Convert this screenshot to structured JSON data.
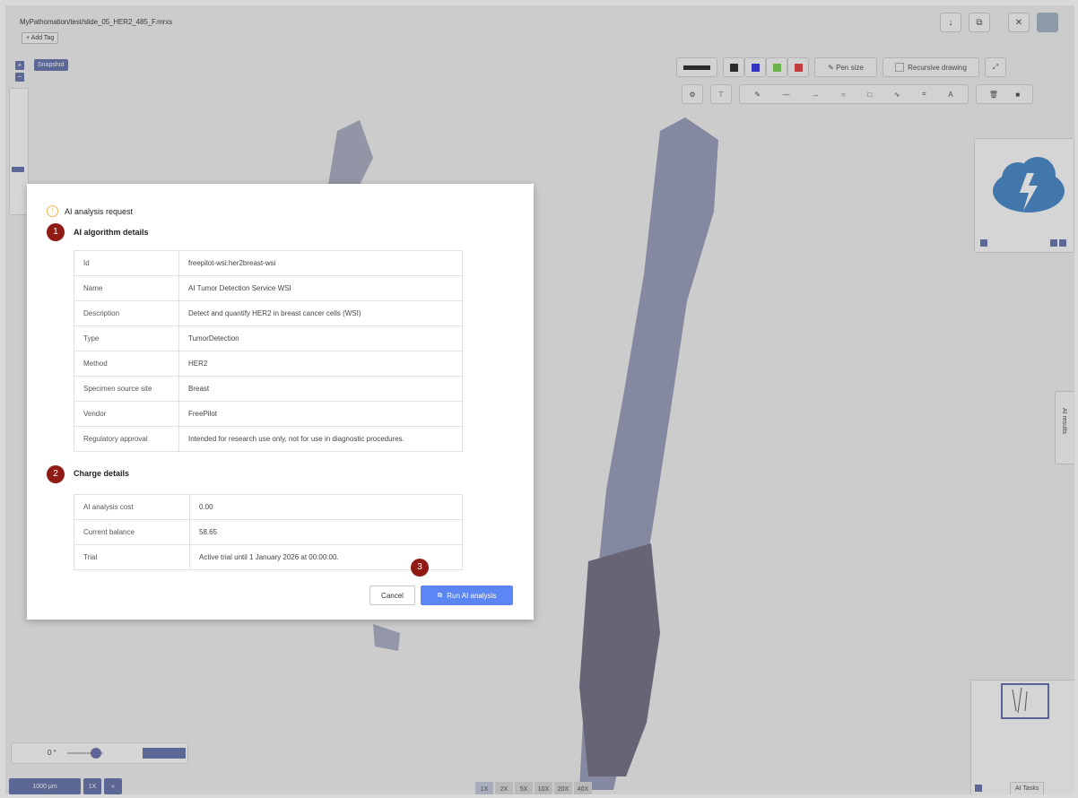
{
  "window": {
    "path": "MyPathomation/test/slide_05_HER2_485_F.mrxs",
    "add_tag": "+ Add Tag"
  },
  "viewer": {
    "snapshot_label": "Snapshot",
    "zoom_in": "+",
    "zoom_out": "−",
    "toolbar": {
      "pen_size": "Pen size",
      "recursive_drawing": "Recursive drawing"
    },
    "rotation": "0 °",
    "scale": "1000 µm",
    "scale_unit": "1X",
    "magnifications": [
      "1X",
      "2X",
      "5X",
      "10X",
      "20X",
      "40X"
    ],
    "ai_tasks": "AI Tasks",
    "ai_results_tab": "AI results"
  },
  "modal": {
    "header": "AI analysis request",
    "section1": {
      "badge": "1",
      "title": "AI algorithm details"
    },
    "algorithm": [
      {
        "k": "Id",
        "v": "freepilot-wsi:her2breast-wsi"
      },
      {
        "k": "Name",
        "v": "AI Tumor Detection Service WSI"
      },
      {
        "k": "Description",
        "v": "Detect and quantify HER2 in breast cancer cells (WSI)"
      },
      {
        "k": "Type",
        "v": "TumorDetection"
      },
      {
        "k": "Method",
        "v": "HER2"
      },
      {
        "k": "Specimen source site",
        "v": "Breast"
      },
      {
        "k": "Vendor",
        "v": "FreePilot"
      },
      {
        "k": "Regulatory approval",
        "v": "Intended for research use only, not for use in diagnostic procedures."
      }
    ],
    "section2": {
      "badge": "2",
      "title": "Charge details"
    },
    "charge": [
      {
        "k": "AI analysis cost",
        "v": "0.00"
      },
      {
        "k": "Current balance",
        "v": "58.65"
      },
      {
        "k": "Trial",
        "v": "Active trial until 1 January 2026 at 00:00:00."
      }
    ],
    "badge3": "3",
    "cancel": "Cancel",
    "run": "Run AI analysis"
  },
  "colors": {
    "accent": "#5f6ea8",
    "run_button": "#5b86f4",
    "badge": "#8f1b14",
    "info": "#f0b44c"
  }
}
